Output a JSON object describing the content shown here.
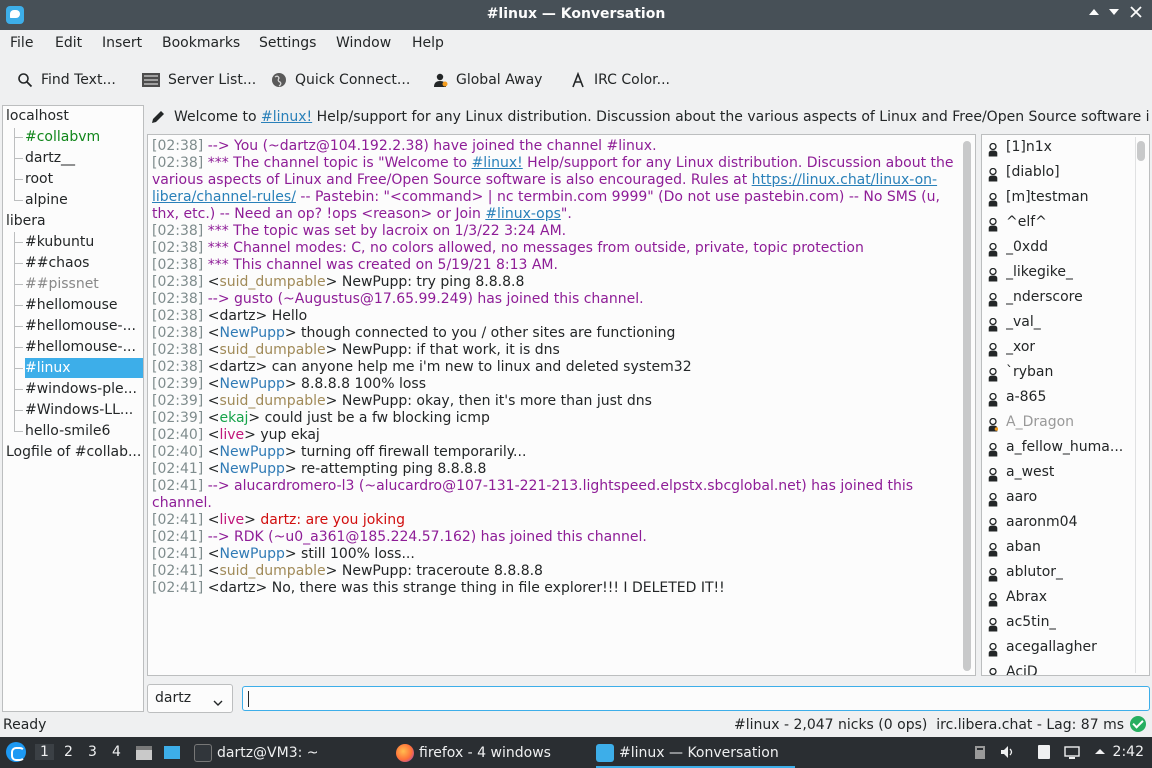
{
  "window": {
    "title": "#linux — Konversation"
  },
  "menu": [
    "File",
    "Edit",
    "Insert",
    "Bookmarks",
    "Settings",
    "Window",
    "Help"
  ],
  "toolbar": {
    "find_text": "Find Text...",
    "server_list": "Server List...",
    "quick_connect": "Quick Connect...",
    "global_away": "Global Away",
    "irc_color": "IRC Color..."
  },
  "tree": {
    "localhost": "localhost",
    "localhost_children": [
      "#collabvm",
      "dartz__",
      "root",
      "alpine"
    ],
    "libera": "libera",
    "libera_children": [
      "#kubuntu",
      "##chaos",
      "##pissnet",
      "#hellomouse",
      "#hellomouse-...",
      "#hellomouse-...",
      "#linux",
      "#windows-ple...",
      "#Windows-LL...",
      "hello-smile6"
    ],
    "logfile": "Logfile of #collab..."
  },
  "topic": {
    "prefix": "Welcome to ",
    "channel": "#linux!",
    "rest": " Help/support for any Linux distribution. Discussion about the various aspects of Linux and Free/Open Source software is..."
  },
  "chat": [
    {
      "ts": "[02:38]",
      "kind": "sys",
      "text": "--> You (~dartz@104.192.2.38) have joined the channel #linux."
    },
    {
      "ts": "[02:38]",
      "kind": "sys",
      "text": "*** The channel topic is \"Welcome to ",
      "link1": "#linux!",
      "text2": " Help/support for any Linux distribution. Discussion about the various aspects of Linux and Free/Open Source software is also encouraged. Rules at ",
      "link2": "https://linux.chat/linux-on-libera/channel-rules/",
      "text3": " -- Pastebin: \"<command> | nc termbin.com 9999\" (Do not use pastebin.com) -- No SMS (u, thx, etc.) -- Need an op? !ops <reason> or Join ",
      "link3": "#linux-ops",
      "text4": "\"."
    },
    {
      "ts": "[02:38]",
      "kind": "sys",
      "text": "*** The topic was set by lacroix on 1/3/22 3:24 AM."
    },
    {
      "ts": "[02:38]",
      "kind": "sys",
      "text": "*** Channel modes: C, no colors allowed, no messages from outside, private, topic protection"
    },
    {
      "ts": "[02:38]",
      "kind": "sys",
      "text": "*** This channel was created on 5/19/21 8:13 AM."
    },
    {
      "ts": "[02:38]",
      "kind": "msg",
      "nick": "suid_dumpable",
      "ncolor": "#a08a58",
      "text": "NewPupp: try ping 8.8.8.8"
    },
    {
      "ts": "[02:38]",
      "kind": "sys",
      "text": "--> gusto (~Augustus@17.65.99.249) has joined this channel."
    },
    {
      "ts": "[02:38]",
      "kind": "msg",
      "nick": "dartz",
      "ncolor": "#232627",
      "text": "Hello"
    },
    {
      "ts": "[02:38]",
      "kind": "msg",
      "nick": "NewPupp",
      "ncolor": "#2f7ab5",
      "text": "though connected to you / other sites are functioning"
    },
    {
      "ts": "[02:38]",
      "kind": "msg",
      "nick": "suid_dumpable",
      "ncolor": "#a08a58",
      "text": "NewPupp: if that work, it is dns"
    },
    {
      "ts": "[02:38]",
      "kind": "msg",
      "nick": "dartz",
      "ncolor": "#232627",
      "text": "can anyone help me i'm new to linux and deleted system32"
    },
    {
      "ts": "[02:39]",
      "kind": "msg",
      "nick": "NewPupp",
      "ncolor": "#2f7ab5",
      "text": "8.8.8.8 100% loss"
    },
    {
      "ts": "[02:39]",
      "kind": "msg",
      "nick": "suid_dumpable",
      "ncolor": "#a08a58",
      "text": "NewPupp: okay, then it's more than just dns"
    },
    {
      "ts": "[02:39]",
      "kind": "msg",
      "nick": "ekaj",
      "ncolor": "#16a34a",
      "text": "could just be a fw blocking icmp"
    },
    {
      "ts": "[02:40]",
      "kind": "msg",
      "nick": "live",
      "ncolor": "#c0157a",
      "text": "yup ekaj"
    },
    {
      "ts": "[02:40]",
      "kind": "msg",
      "nick": "NewPupp",
      "ncolor": "#2f7ab5",
      "text": "turning off firewall temporarily..."
    },
    {
      "ts": "[02:41]",
      "kind": "msg",
      "nick": "NewPupp",
      "ncolor": "#2f7ab5",
      "text": "re-attempting ping 8.8.8.8"
    },
    {
      "ts": "[02:41]",
      "kind": "sys",
      "text": "--> alucardromero-l3 (~alucardro@107-131-221-213.lightspeed.elpstx.sbcglobal.net) has joined this channel."
    },
    {
      "ts": "[02:41]",
      "kind": "msg",
      "nick": "live",
      "ncolor": "#c0157a",
      "text": "dartz: are you joking",
      "tcolor": "#d10f0f"
    },
    {
      "ts": "[02:41]",
      "kind": "sys",
      "text": "--> RDK (~u0_a361@185.224.57.162) has joined this channel."
    },
    {
      "ts": "[02:41]",
      "kind": "msg",
      "nick": "NewPupp",
      "ncolor": "#2f7ab5",
      "text": "still 100% loss..."
    },
    {
      "ts": "[02:41]",
      "kind": "msg",
      "nick": "suid_dumpable",
      "ncolor": "#a08a58",
      "text": "NewPupp: traceroute 8.8.8.8"
    },
    {
      "ts": "[02:41]",
      "kind": "msg",
      "nick": "dartz",
      "ncolor": "#232627",
      "text": "No, there was this strange thing in file explorer!!! I DELETED IT!!"
    }
  ],
  "nicks": [
    {
      "name": "[1]n1x"
    },
    {
      "name": "[diablo]"
    },
    {
      "name": "[m]testman"
    },
    {
      "name": "^elf^"
    },
    {
      "name": "_0xdd"
    },
    {
      "name": "_likegike_"
    },
    {
      "name": "_nderscore"
    },
    {
      "name": "_val_"
    },
    {
      "name": "_xor"
    },
    {
      "name": "`ryban"
    },
    {
      "name": "a-865"
    },
    {
      "name": "A_Dragon",
      "away": true
    },
    {
      "name": "a_fellow_huma..."
    },
    {
      "name": "a_west"
    },
    {
      "name": "aaro"
    },
    {
      "name": "aaronm04"
    },
    {
      "name": "aban"
    },
    {
      "name": "ablutor_"
    },
    {
      "name": "Abrax"
    },
    {
      "name": "ac5tin_"
    },
    {
      "name": "acegallagher"
    },
    {
      "name": "AciD"
    }
  ],
  "input": {
    "nick": "dartz",
    "value": ""
  },
  "status": {
    "left": "Ready",
    "right": "#linux - 2,047 nicks (0 ops)  irc.libera.chat - Lag: 87 ms"
  },
  "taskbar": {
    "desktops": [
      "1",
      "2",
      "3",
      "4"
    ],
    "tasks": [
      "dartz@VM3: ~",
      "firefox - 4 windows",
      "#linux — Konversation"
    ],
    "clock": "2:42"
  },
  "colors": {
    "accent": "#3daee9",
    "system_text": "#8e1d97",
    "link": "#2980b9"
  }
}
